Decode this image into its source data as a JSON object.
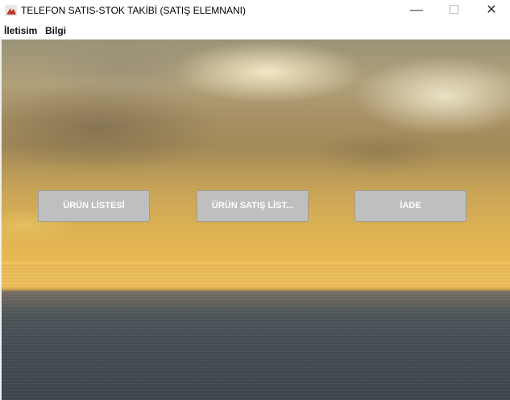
{
  "window": {
    "title": "TELEFON SATIS-STOK TAKİBİ (SATIŞ ELEMNANI)",
    "minimize_glyph": "—",
    "close_glyph": "✕",
    "app_icon": "java-cup-icon"
  },
  "menu": {
    "items": [
      {
        "label": "İletisim"
      },
      {
        "label": "Bilgi"
      }
    ]
  },
  "buttons": {
    "urun_listesi": "ÜRÜN LİSTESİ",
    "urun_satis_listesi": "ÜRÜN SATIŞ LİST...",
    "iade": "İADE"
  },
  "background": {
    "image": "sunset-over-sea",
    "sky_color": "#e0b452",
    "sea_color": "#424c52"
  }
}
